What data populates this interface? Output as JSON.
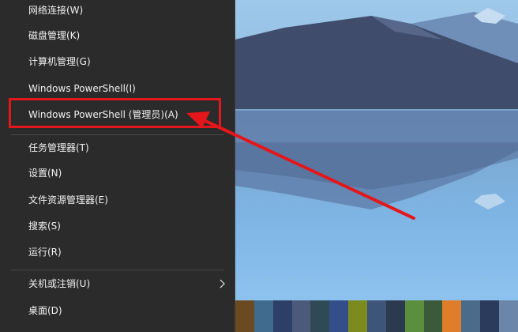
{
  "menu": {
    "items": [
      {
        "label": "网络连接(W)"
      },
      {
        "label": "磁盘管理(K)"
      },
      {
        "label": "计算机管理(G)"
      },
      {
        "label": "Windows PowerShell(I)"
      },
      {
        "label": "Windows PowerShell (管理员)(A)"
      },
      {
        "label": "任务管理器(T)"
      },
      {
        "label": "设置(N)"
      },
      {
        "label": "文件资源管理器(E)"
      },
      {
        "label": "搜索(S)"
      },
      {
        "label": "运行(R)"
      },
      {
        "label": "关机或注销(U)"
      },
      {
        "label": "桌面(D)"
      }
    ]
  },
  "colors": {
    "menu_bg": "#2b2b2b",
    "menu_text": "#f2f2f2",
    "annotation_red": "#e3171b"
  },
  "icons": {
    "submenu": "chevron-right-icon"
  }
}
